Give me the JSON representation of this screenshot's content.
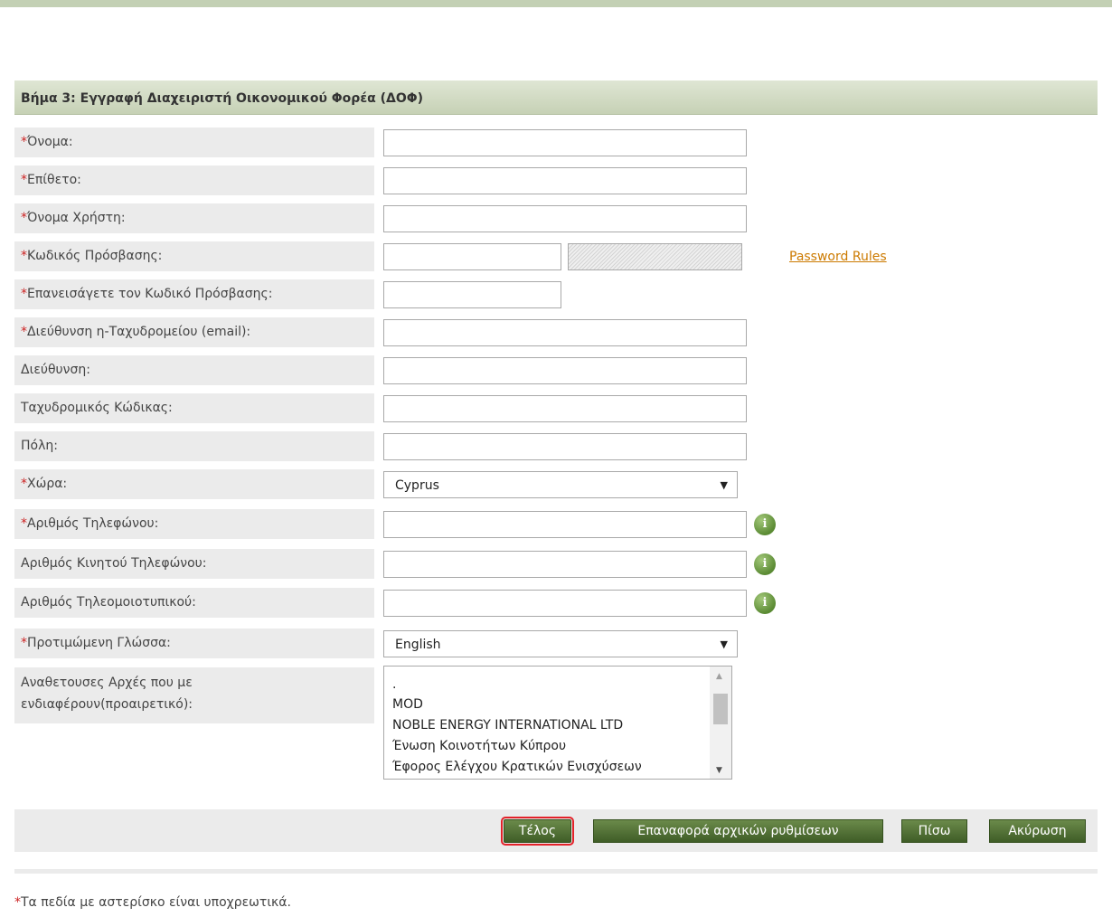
{
  "panel": {
    "title": "Βήμα 3: Εγγραφή Διαχειριστή Οικονομικού Φορέα (ΔΟΦ)"
  },
  "required_mark": "*",
  "fields": {
    "first_name": {
      "label": "Όνομα:",
      "value": ""
    },
    "last_name": {
      "label": "Επίθετο:",
      "value": ""
    },
    "username": {
      "label": "Όνομα Χρήστη:",
      "value": ""
    },
    "password": {
      "label": "Κωδικός Πρόσβασης:",
      "value": ""
    },
    "password_confirm": {
      "label": "Επανεισάγετε τον Κωδικό Πρόσβασης:",
      "value": ""
    },
    "email": {
      "label": "Διεύθυνση η-Ταχυδρομείου (email):",
      "value": ""
    },
    "address": {
      "label": "Διεύθυνση:",
      "value": ""
    },
    "postal_code": {
      "label": "Ταχυδρομικός Κώδικας:",
      "value": ""
    },
    "city": {
      "label": "Πόλη:",
      "value": ""
    },
    "country": {
      "label": "Χώρα:",
      "selected": "Cyprus"
    },
    "phone": {
      "label": "Αριθμός Τηλεφώνου:",
      "value": ""
    },
    "mobile": {
      "label": "Αριθμός Κινητού Τηλεφώνου:",
      "value": ""
    },
    "fax": {
      "label": "Αριθμός Τηλεομοιοτυπικού:",
      "value": ""
    },
    "language": {
      "label": "Προτιμώμενη Γλώσσα:",
      "selected": "English"
    },
    "authorities": {
      "label_line1": "Αναθετουσες Αρχές που με",
      "label_line2": "ενδιαφέρουν(προαιρετικό):",
      "options": [
        ".",
        "MOD",
        "NOBLE ENERGY INTERNATIONAL LTD",
        "Ένωση Κοινοτήτων Κύπρου",
        "Έφορος Ελέγχου Κρατικών Ενισχύσεων"
      ]
    }
  },
  "password_rules_link": "Password Rules",
  "buttons": {
    "finish": "Τέλος",
    "reset": "Επαναφορά αρχικών ρυθμίσεων",
    "back": "Πίσω",
    "cancel": "Ακύρωση"
  },
  "footnote": "Τα πεδία με αστερίσκο είναι υποχρεωτικά.",
  "icons": {
    "info": "info-icon",
    "dropdown": "chevron-down-icon"
  },
  "colors": {
    "header_bg": "#c6d1b5",
    "label_bg": "#ebebeb",
    "required": "#cc2222",
    "link": "#cc7a00",
    "button": "#4f6e35",
    "focus_ring": "#e3222a"
  }
}
